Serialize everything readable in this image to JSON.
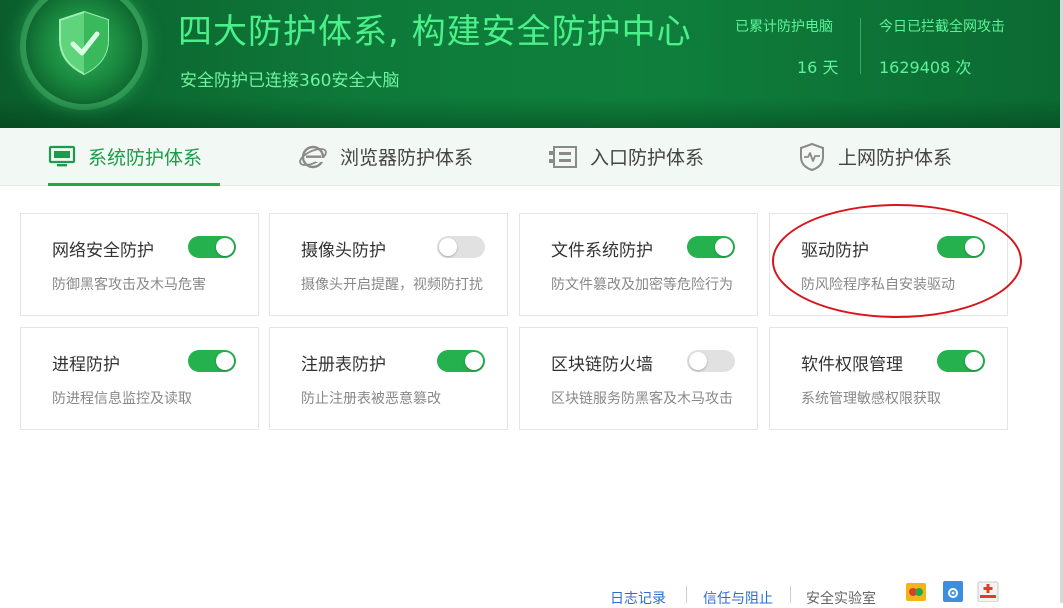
{
  "header": {
    "title": "四大防护体系, 构建安全防护中心",
    "subtitle": "安全防护已连接360安全大脑",
    "stats": [
      {
        "label": "已累计防护电脑",
        "value": "16 天"
      },
      {
        "label": "今日已拦截全网攻击",
        "value": "1629408 次"
      }
    ]
  },
  "tabs": [
    {
      "label": "系统防护体系",
      "icon": "monitor-icon",
      "active": true
    },
    {
      "label": "浏览器防护体系",
      "icon": "ie-browser-icon",
      "active": false
    },
    {
      "label": "入口防护体系",
      "icon": "entry-icon",
      "active": false
    },
    {
      "label": "上网防护体系",
      "icon": "shield-pulse-icon",
      "active": false
    }
  ],
  "cards": [
    {
      "title": "网络安全防护",
      "desc": "防御黑客攻击及木马危害",
      "enabled": true
    },
    {
      "title": "摄像头防护",
      "desc": "摄像头开启提醒，视频防打扰",
      "enabled": false
    },
    {
      "title": "文件系统防护",
      "desc": "防文件篡改及加密等危险行为",
      "enabled": true
    },
    {
      "title": "驱动防护",
      "desc": "防风险程序私自安装驱动",
      "enabled": true
    },
    {
      "title": "进程防护",
      "desc": "防进程信息监控及读取",
      "enabled": true
    },
    {
      "title": "注册表防护",
      "desc": "防止注册表被恶意篡改",
      "enabled": true
    },
    {
      "title": "区块链防火墙",
      "desc": "区块链服务防黑客及木马攻击",
      "enabled": false
    },
    {
      "title": "软件权限管理",
      "desc": "系统管理敏感权限获取",
      "enabled": true
    }
  ],
  "footer": {
    "links": [
      "日志记录",
      "信任与阻止",
      "安全实验室"
    ]
  },
  "colors": {
    "accent": "#26b14f",
    "header_text": "#4bf08a",
    "annotation": "#d9141b"
  }
}
